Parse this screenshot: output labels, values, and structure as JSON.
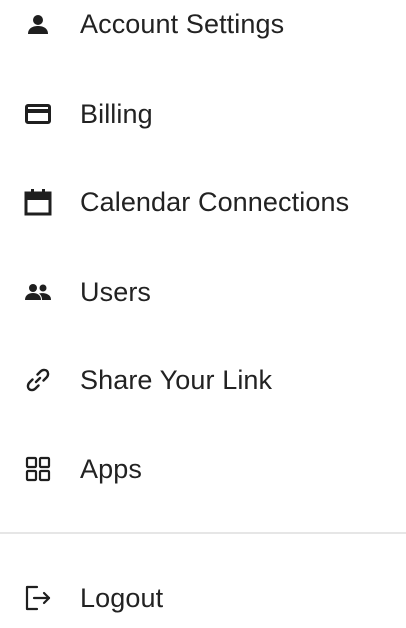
{
  "menu": {
    "items": [
      {
        "label": "Account Settings",
        "icon": "user-icon"
      },
      {
        "label": "Billing",
        "icon": "credit-card-icon"
      },
      {
        "label": "Calendar Connections",
        "icon": "calendar-icon"
      },
      {
        "label": "Users",
        "icon": "users-icon"
      },
      {
        "label": "Share Your Link",
        "icon": "link-icon"
      },
      {
        "label": "Apps",
        "icon": "apps-grid-icon"
      }
    ],
    "logout": {
      "label": "Logout",
      "icon": "logout-icon"
    }
  },
  "colors": {
    "text": "#222222",
    "icon": "#1f1f1f",
    "divider": "#e6e6e6"
  }
}
